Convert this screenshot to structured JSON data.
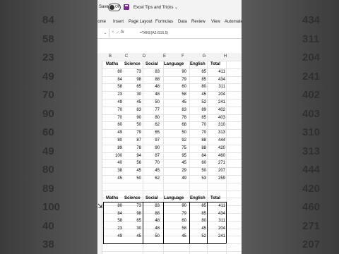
{
  "app": {
    "autosave_label": "Save",
    "autosave_toggle": "Off",
    "file_name": "Excel Tips and Tricks",
    "file_chevron": "⌄",
    "ribbon_tabs": [
      "Home",
      "Insert",
      "Page Layout",
      "Formulas",
      "Data",
      "Review",
      "View",
      "Automate"
    ],
    "name_box_chevron": "⌄",
    "cancel_symbol": "×",
    "enter_symbol": "✓",
    "fx_label": "fx",
    "formula": "=TAKE(A2:G16,5)"
  },
  "columns": [
    "B",
    "C",
    "D",
    "E",
    "F",
    "G",
    "H"
  ],
  "table": {
    "headers": [
      "Maths",
      "Science",
      "Social",
      "Language",
      "English",
      "Total"
    ],
    "rows": [
      [
        "80",
        "73",
        "83",
        "90",
        "85",
        "411"
      ],
      [
        "84",
        "98",
        "88",
        "79",
        "85",
        "434"
      ],
      [
        "58",
        "65",
        "48",
        "60",
        "80",
        "311"
      ],
      [
        "23",
        "30",
        "48",
        "58",
        "45",
        "204"
      ],
      [
        "49",
        "45",
        "50",
        "45",
        "52",
        "241"
      ],
      [
        "70",
        "83",
        "77",
        "83",
        "89",
        "402"
      ],
      [
        "70",
        "90",
        "80",
        "78",
        "85",
        "403"
      ],
      [
        "60",
        "50",
        "62",
        "68",
        "70",
        "310"
      ],
      [
        "49",
        "79",
        "65",
        "50",
        "70",
        "313"
      ],
      [
        "80",
        "87",
        "97",
        "92",
        "88",
        "444"
      ],
      [
        "89",
        "78",
        "90",
        "75",
        "88",
        "420"
      ],
      [
        "100",
        "94",
        "87",
        "95",
        "84",
        "460"
      ],
      [
        "40",
        "56",
        "70",
        "45",
        "60",
        "271"
      ],
      [
        "38",
        "45",
        "45",
        "29",
        "50",
        "207"
      ],
      [
        "45",
        "50",
        "62",
        "49",
        "53",
        "259"
      ]
    ]
  },
  "result": {
    "headers": [
      "Maths",
      "Science",
      "Social",
      "Language",
      "English",
      "Total"
    ],
    "rows": [
      [
        "80",
        "73",
        "83",
        "90",
        "85",
        "411"
      ],
      [
        "84",
        "98",
        "88",
        "79",
        "85",
        "434"
      ],
      [
        "58",
        "65",
        "48",
        "60",
        "80",
        "311"
      ],
      [
        "23",
        "30",
        "48",
        "58",
        "45",
        "204"
      ],
      [
        "49",
        "45",
        "50",
        "45",
        "52",
        "241"
      ]
    ]
  },
  "background_left": [
    "84",
    "58",
    "23",
    "49",
    "70",
    "90",
    "60",
    "49",
    "80",
    "89",
    "100",
    "40",
    "38"
  ],
  "background_right": [
    "434",
    "311",
    "204",
    "241",
    "402",
    "403",
    "310",
    "313",
    "444",
    "420",
    "460",
    "271",
    "207"
  ],
  "background_left_partial": [
    "s",
    "8",
    "s",
    "("
  ],
  "colors": {
    "save_icon": "#7b2a8f",
    "sheet_bg": "#ffffff",
    "chrome": "#f3f3f3"
  }
}
